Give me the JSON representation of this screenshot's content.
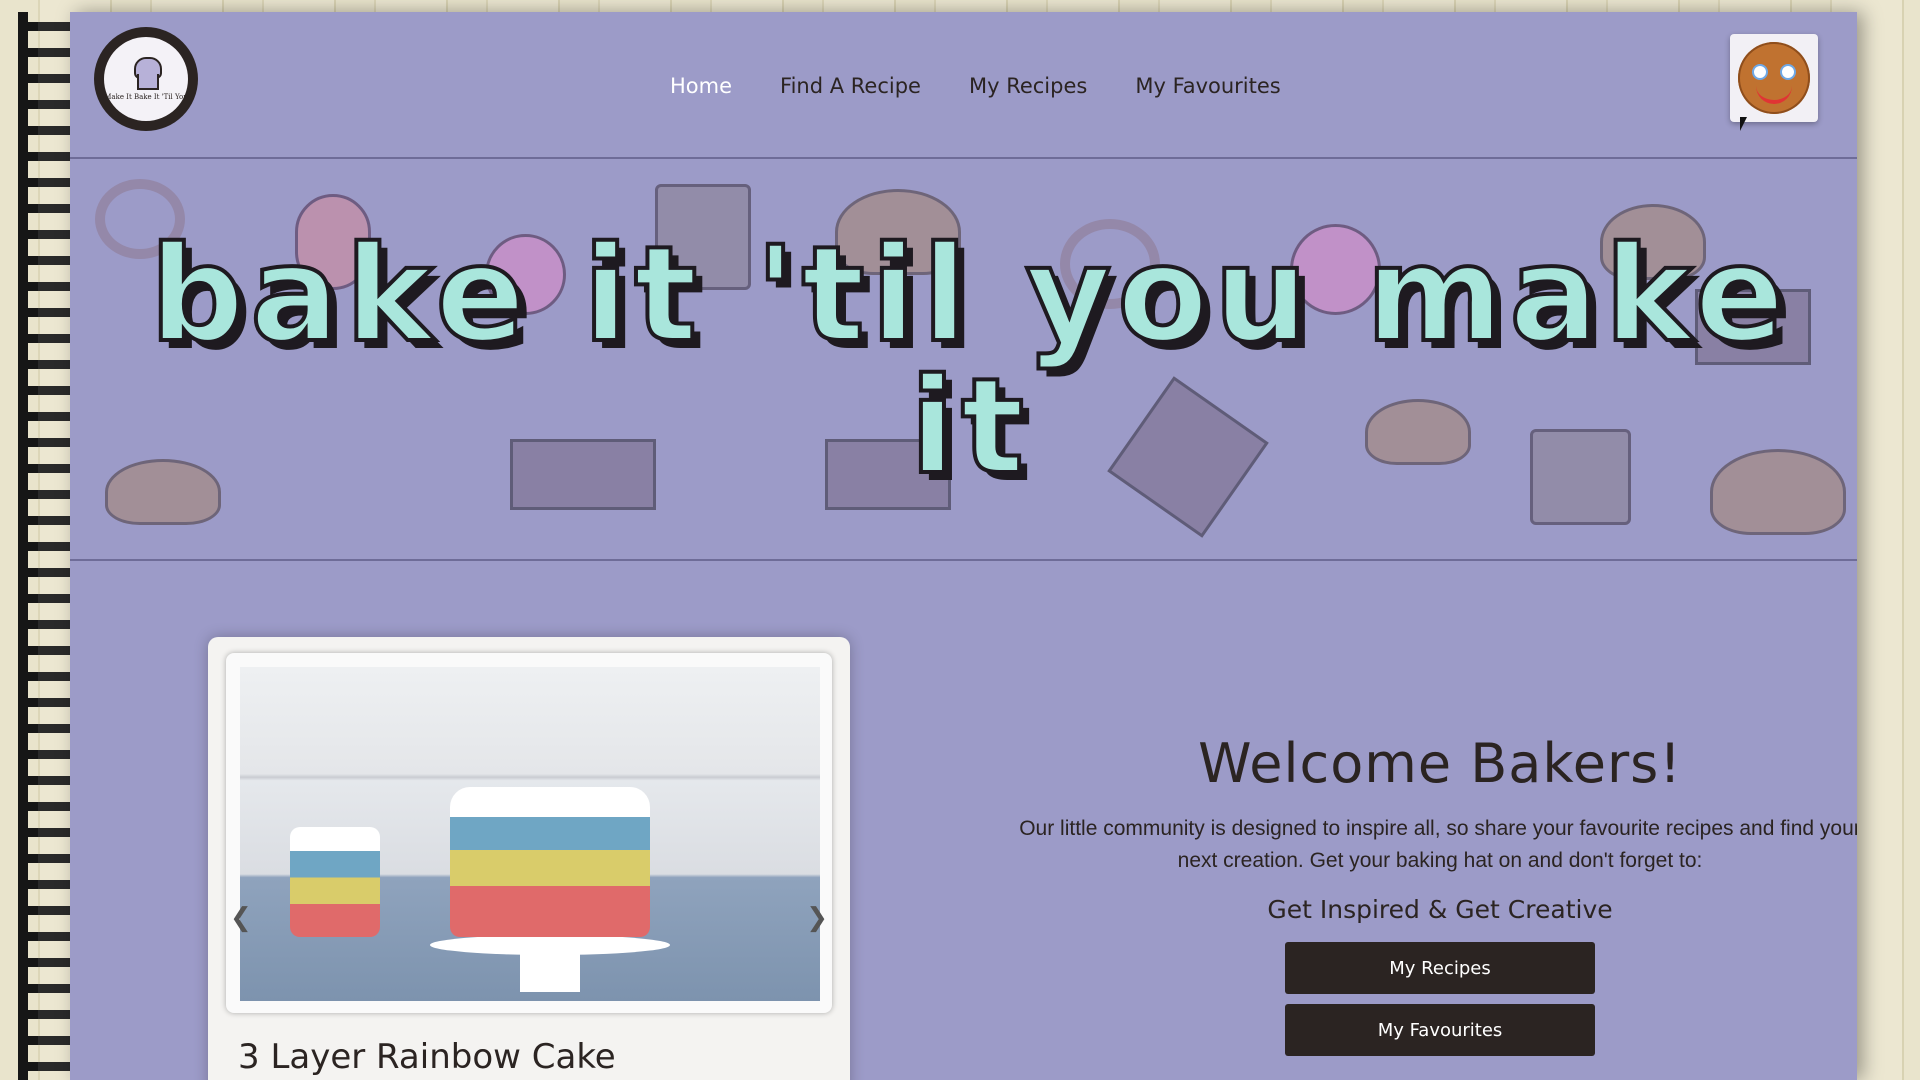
{
  "colors": {
    "page": "#9c9bc8",
    "text": "#2b2422",
    "button": "#2b2422",
    "title_fill": "#a9e6dc"
  },
  "logo": {
    "text": "Make It Bake It 'Til You"
  },
  "nav": {
    "items": [
      {
        "label": "Home",
        "active": true
      },
      {
        "label": "Find A Recipe",
        "active": false
      },
      {
        "label": "My Recipes",
        "active": false
      },
      {
        "label": "My Favourites",
        "active": false
      }
    ]
  },
  "profile": {
    "icon": "gingerbread-icon"
  },
  "hero": {
    "title": "bake it 'til you make it"
  },
  "carousel": {
    "caption": "3 Layer Rainbow Cake",
    "prev_icon": "chevron-left-icon",
    "next_icon": "chevron-right-icon"
  },
  "welcome": {
    "heading": "Welcome Bakers!",
    "body": "Our little community is designed to inspire all, so share your favourite recipes and find your next creation. Get your baking hat on and don't forget to:",
    "tagline": "Get Inspired & Get Creative",
    "button_recipes": "My Recipes",
    "button_favourites": "My Favourites"
  }
}
